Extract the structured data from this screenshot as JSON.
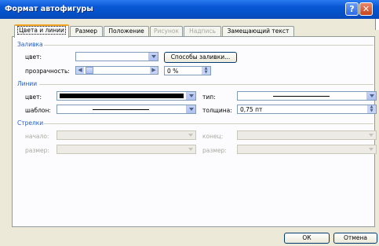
{
  "window": {
    "title": "Формат автофигуры"
  },
  "tabs": [
    {
      "label": "Цвета и линии",
      "active": true,
      "disabled": false
    },
    {
      "label": "Размер",
      "active": false,
      "disabled": false
    },
    {
      "label": "Положение",
      "active": false,
      "disabled": false
    },
    {
      "label": "Рисунок",
      "active": false,
      "disabled": true
    },
    {
      "label": "Надпись",
      "active": false,
      "disabled": true
    },
    {
      "label": "Замещающий текст",
      "active": false,
      "disabled": false
    }
  ],
  "fill": {
    "section": "Заливка",
    "color_label": "цвет:",
    "fill_effects_button": "Способы заливки...",
    "transparency_label": "прозрачность:",
    "transparency_value": "0 %"
  },
  "lines": {
    "section": "Линии",
    "color_label": "цвет:",
    "style_label": "шаблон:",
    "type_label": "тип:",
    "weight_label": "толщина:",
    "weight_value": "0,75 пт"
  },
  "arrows": {
    "section": "Стрелки",
    "begin_label": "начало:",
    "end_label": "конец:",
    "begin_size_label": "размер:",
    "end_size_label": "размер:"
  },
  "buttons": {
    "ok": "ОК",
    "cancel": "Отмена"
  },
  "colors": {
    "title_bar": "#0a57d6",
    "section_label": "#1f5bd6",
    "dialog_bg": "#ece9d8"
  }
}
